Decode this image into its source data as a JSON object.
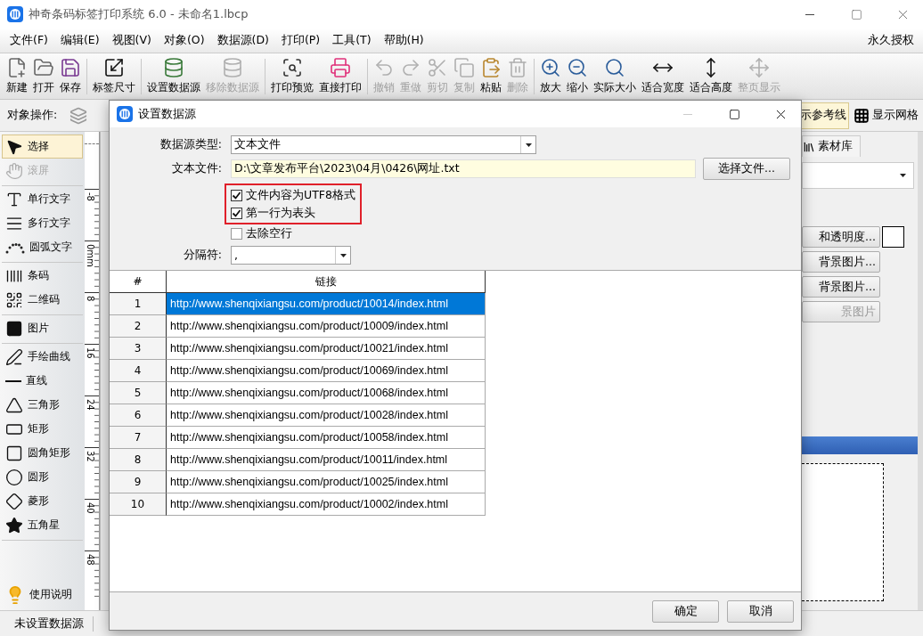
{
  "window": {
    "title": "神奇条码标签打印系统 6.0 - 未命名1.lbcp"
  },
  "menu": {
    "items": [
      "文件(F)",
      "编辑(E)",
      "视图(V)",
      "对象(O)",
      "数据源(D)",
      "打印(P)",
      "工具(T)",
      "帮助(H)"
    ],
    "right": "永久授权"
  },
  "toolbar": {
    "groups": [
      [
        {
          "label": "新建",
          "disabled": false
        },
        {
          "label": "打开",
          "disabled": false
        },
        {
          "label": "保存",
          "disabled": false
        }
      ],
      [
        {
          "label": "标签尺寸",
          "disabled": false
        }
      ],
      [
        {
          "label": "设置数据源",
          "disabled": false
        },
        {
          "label": "移除数据源",
          "disabled": true
        }
      ],
      [
        {
          "label": "打印预览",
          "disabled": false
        },
        {
          "label": "直接打印",
          "disabled": false
        }
      ],
      [
        {
          "label": "撤销",
          "disabled": true
        },
        {
          "label": "重做",
          "disabled": true
        },
        {
          "label": "剪切",
          "disabled": true
        },
        {
          "label": "复制",
          "disabled": true
        },
        {
          "label": "粘贴",
          "disabled": false
        },
        {
          "label": "删除",
          "disabled": true
        }
      ],
      [
        {
          "label": "放大",
          "disabled": false
        },
        {
          "label": "缩小",
          "disabled": false
        },
        {
          "label": "实际大小",
          "disabled": false
        },
        {
          "label": "适合宽度",
          "disabled": false
        },
        {
          "label": "适合高度",
          "disabled": false
        },
        {
          "label": "整页显示",
          "disabled": true
        }
      ]
    ]
  },
  "object_ops": {
    "label": "对象操作:",
    "toggles": [
      {
        "label": "示参考线",
        "selected": true
      },
      {
        "label": "显示网格",
        "selected": false
      }
    ]
  },
  "sidebar": {
    "groups": [
      [
        {
          "label": "选择",
          "selected": true,
          "disabled": false
        },
        {
          "label": "滚屏",
          "selected": false,
          "disabled": true
        }
      ],
      [
        {
          "label": "单行文字",
          "selected": false,
          "disabled": false
        },
        {
          "label": "多行文字",
          "selected": false,
          "disabled": false
        },
        {
          "label": "圆弧文字",
          "selected": false,
          "disabled": false
        }
      ],
      [
        {
          "label": "条码",
          "selected": false,
          "disabled": false
        },
        {
          "label": "二维码",
          "selected": false,
          "disabled": false
        }
      ],
      [
        {
          "label": "图片",
          "selected": false,
          "disabled": false
        }
      ],
      [
        {
          "label": "手绘曲线",
          "selected": false,
          "disabled": false
        },
        {
          "label": "直线",
          "selected": false,
          "disabled": false
        },
        {
          "label": "三角形",
          "selected": false,
          "disabled": false
        },
        {
          "label": "矩形",
          "selected": false,
          "disabled": false
        },
        {
          "label": "圆角矩形",
          "selected": false,
          "disabled": false
        },
        {
          "label": "圆形",
          "selected": false,
          "disabled": false
        },
        {
          "label": "菱形",
          "selected": false,
          "disabled": false
        },
        {
          "label": "五角星",
          "selected": false,
          "disabled": false
        }
      ]
    ],
    "help": "使用说明"
  },
  "ruler": {
    "labels": [
      "-8",
      "0mm",
      "8",
      "16",
      "24",
      "32",
      "40",
      "48"
    ]
  },
  "right_panel": {
    "tab": "素材库",
    "buttons": [
      {
        "label": "和透明度...",
        "disabled": false
      },
      {
        "label": "背景图片...",
        "disabled": false
      },
      {
        "label": "背景图片...",
        "disabled": false
      },
      {
        "label": "景图片",
        "disabled": true
      }
    ]
  },
  "status_bar": [
    "未设置数据源"
  ],
  "dialog": {
    "title": "设置数据源",
    "type_label": "数据源类型:",
    "type_value": "文本文件",
    "file_label": "文本文件:",
    "file_value": "D:\\文章发布平台\\2023\\04月\\0426\\网址.txt",
    "browse_button": "选择文件...",
    "options": [
      {
        "label": "文件内容为UTF8格式",
        "checked": true,
        "highlighted": true
      },
      {
        "label": "第一行为表头",
        "checked": true,
        "highlighted": true
      },
      {
        "label": "去除空行",
        "checked": false,
        "highlighted": false
      }
    ],
    "separator_label": "分隔符:",
    "separator_value": ",",
    "table": {
      "columns": [
        "#",
        "链接"
      ],
      "rows": [
        {
          "index": "1",
          "link": "http://www.shenqixiangsu.com/product/10014/index.html",
          "selected": true
        },
        {
          "index": "2",
          "link": "http://www.shenqixiangsu.com/product/10009/index.html",
          "selected": false
        },
        {
          "index": "3",
          "link": "http://www.shenqixiangsu.com/product/10021/index.html",
          "selected": false
        },
        {
          "index": "4",
          "link": "http://www.shenqixiangsu.com/product/10069/index.html",
          "selected": false
        },
        {
          "index": "5",
          "link": "http://www.shenqixiangsu.com/product/10068/index.html",
          "selected": false
        },
        {
          "index": "6",
          "link": "http://www.shenqixiangsu.com/product/10028/index.html",
          "selected": false
        },
        {
          "index": "7",
          "link": "http://www.shenqixiangsu.com/product/10058/index.html",
          "selected": false
        },
        {
          "index": "8",
          "link": "http://www.shenqixiangsu.com/product/10011/index.html",
          "selected": false
        },
        {
          "index": "9",
          "link": "http://www.shenqixiangsu.com/product/10025/index.html",
          "selected": false
        },
        {
          "index": "10",
          "link": "http://www.shenqixiangsu.com/product/10002/index.html",
          "selected": false
        }
      ]
    },
    "buttons": [
      "确定",
      "取消"
    ]
  }
}
